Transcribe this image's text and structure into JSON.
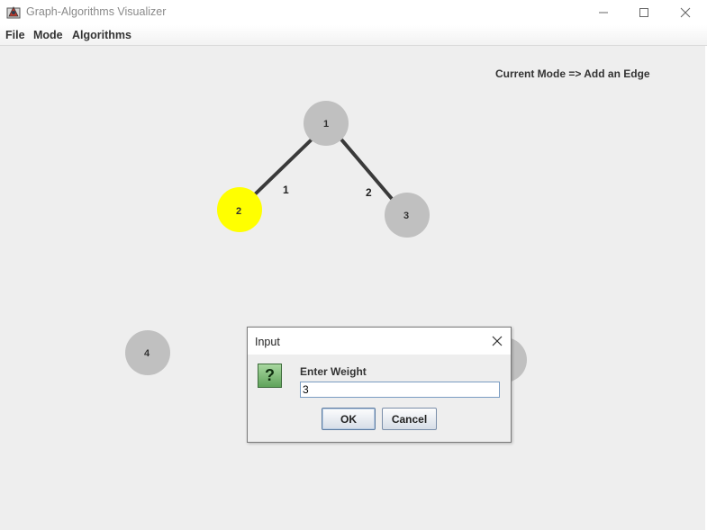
{
  "window": {
    "title": "Graph-Algorithms Visualizer"
  },
  "menu": {
    "items": [
      "File",
      "Mode",
      "Algorithms"
    ]
  },
  "status": {
    "mode_text": "Current Mode => Add an Edge"
  },
  "graph": {
    "nodes": [
      {
        "id": "1",
        "color": "#c0c0c0"
      },
      {
        "id": "2",
        "color": "#ffff00"
      },
      {
        "id": "3",
        "color": "#c0c0c0"
      },
      {
        "id": "4",
        "color": "#c0c0c0"
      },
      {
        "id": "5",
        "color": "#c0c0c0"
      }
    ],
    "edges": [
      {
        "from": "1",
        "to": "2",
        "weight": "1"
      },
      {
        "from": "1",
        "to": "3",
        "weight": "2"
      }
    ]
  },
  "dialog": {
    "title": "Input",
    "prompt": "Enter Weight",
    "input_value": "3",
    "ok_label": "OK",
    "cancel_label": "Cancel"
  }
}
